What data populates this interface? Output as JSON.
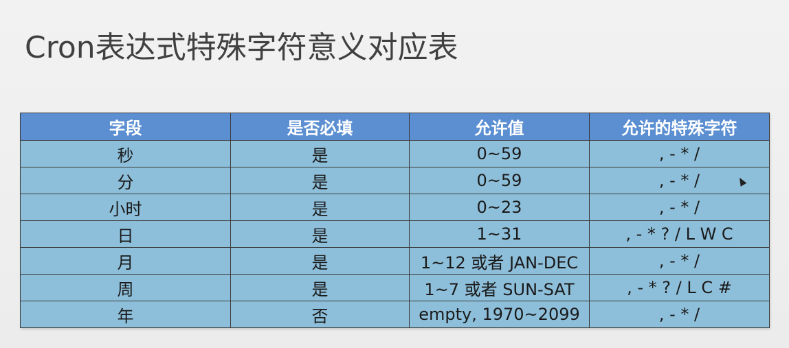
{
  "title": "Cron表达式特殊字符意义对应表",
  "table": {
    "headers": [
      "字段",
      "是否必填",
      "允许值",
      "允许的特殊字符"
    ],
    "rows": [
      [
        "秒",
        "是",
        "0~59",
        ", - * /"
      ],
      [
        "分",
        "是",
        "0~59",
        ", - * /"
      ],
      [
        "小时",
        "是",
        "0~23",
        ", - * /"
      ],
      [
        "日",
        "是",
        "1~31",
        ", - * ? / L W C"
      ],
      [
        "月",
        "是",
        "1~12 或者 JAN-DEC",
        ", - * /"
      ],
      [
        "周",
        "是",
        "1~7 或者 SUN-SAT",
        ", - * ? / L C #"
      ],
      [
        "年",
        "否",
        "empty, 1970~2099",
        ", - * /"
      ]
    ]
  },
  "colors": {
    "header_bg": "#5b8fd2",
    "cell_bg": "#8ebfda",
    "title_color": "#404040"
  }
}
